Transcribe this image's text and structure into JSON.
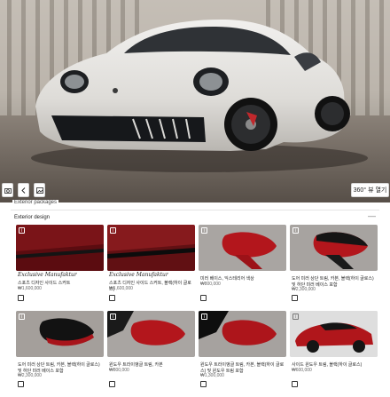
{
  "hero": {
    "view_360_label": "360° 뷰 열기",
    "icons": [
      "camera-icon",
      "chevron-left-icon",
      "photo-icon"
    ]
  },
  "panel": {
    "section_label": "Exterior packages",
    "group_title": "Exterior design",
    "collapse_symbol": "—"
  },
  "options": [
    {
      "name": "스포츠 디자인 사이드 스커트",
      "price": "₩1,600,000",
      "script": "Exclusive Manufaktur",
      "kind": "skirt-red"
    },
    {
      "name": "스포츠 디자인 사이드 스커트, 블랙(하이 글로스)",
      "price": "₩1,600,000",
      "script": "Exclusive Manufaktur",
      "kind": "skirt-black"
    },
    {
      "name": "미러 베이스, 익스테리어 색상",
      "price": "₩800,000",
      "script": "",
      "kind": "mirror-red"
    },
    {
      "name": "도어 미러 상단 트림, 카본, 블랙(하이 글로스) 및 하단 미러 베이스 포함",
      "price": "₩2,300,000",
      "script": "",
      "kind": "mirror-carbon"
    },
    {
      "name": "도어 미러 상단 트림, 카본, 블랙(하이 글로스) 및 하단 미러 베이스 포함",
      "price": "₩2,300,000",
      "script": "",
      "kind": "mirror-black-top"
    },
    {
      "name": "윈도우 트라이앵글 트림, 카본",
      "price": "₩800,000",
      "script": "",
      "kind": "mirror-red-2"
    },
    {
      "name": "윈도우 트라이앵글 트림, 카본, 블랙(하이 글로스) 및 윈도우 트림 포함",
      "price": "₩1,300,000",
      "script": "",
      "kind": "mirror-red-3"
    },
    {
      "name": "사이드 윈도우 트림, 블랙(하이 글로스)",
      "price": "₩600,000",
      "script": "",
      "kind": "car-side"
    }
  ]
}
